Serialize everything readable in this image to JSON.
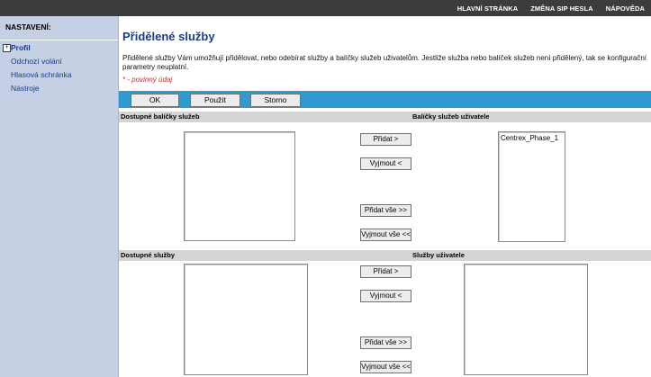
{
  "topnav": {
    "home": "HLAVNÍ STRÁNKA",
    "change_sip_password": "ZMĚNA SIP HESLA",
    "help": "NÁPOVĚDA"
  },
  "sidebar": {
    "heading": "NASTAVENÍ:",
    "items": [
      {
        "label": "Profil",
        "active": true
      },
      {
        "label": "Odchozí volání"
      },
      {
        "label": "Hlasová schránka"
      },
      {
        "label": "Nástroje"
      }
    ]
  },
  "main": {
    "title": "Přidělené služby",
    "description": "Přidělené služby Vám umožňují přidělovat, nebo odebírat služby a balíčky služeb uživatelům. Jestliže služba nebo balíček služeb není přidělený, tak se konfigurační parametry neuplatní.",
    "required_note": "* - povinný údaj",
    "buttons": {
      "ok": "OK",
      "apply": "Použít",
      "cancel": "Storno"
    },
    "packages": {
      "available_header": "Dostupné balíčky služeb",
      "user_header": "Balíčky služeb uživatele",
      "available_items": [],
      "user_items": [
        "Centrex_Phase_1"
      ],
      "add": "Přidat >",
      "remove": "Vyjmout <",
      "add_all": "Přidat vše >>",
      "remove_all": "Vyjmout vše <<"
    },
    "services": {
      "available_header": "Dostupné služby",
      "user_header": "Služby uživatele",
      "available_items": [],
      "user_items": [],
      "add": "Přidat >",
      "remove": "Vyjmout <",
      "add_all": "Přidat vše >>",
      "remove_all": "Vyjmout vše <<"
    }
  }
}
